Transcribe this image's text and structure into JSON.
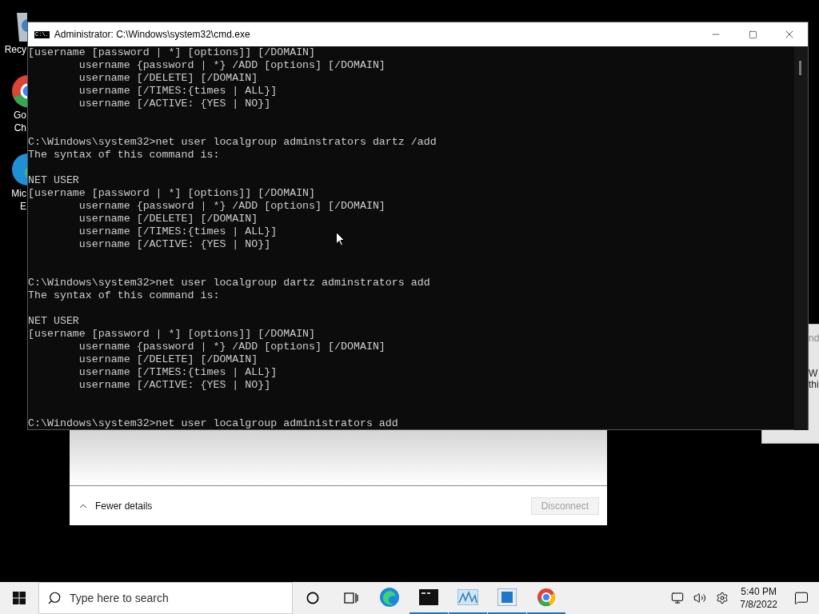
{
  "desktop_icons": [
    {
      "label_lines": [
        "Recy"
      ]
    },
    {
      "label_lines": [
        "Go",
        "Ch"
      ]
    },
    {
      "label_lines": [
        "Mic",
        "E"
      ]
    }
  ],
  "background_window": {
    "texts": [
      "nd",
      "W",
      "thi"
    ]
  },
  "network_dialog": {
    "details_toggle": "Fewer details",
    "disconnect": {
      "label": "Disconnect",
      "disabled": true
    }
  },
  "console": {
    "title": "Administrator: C:\\Windows\\system32\\cmd.exe",
    "icon_text": "C:\\.",
    "lines": [
      {
        "kind": "text",
        "text": "[username [password | *] [options]] [/DOMAIN]"
      },
      {
        "kind": "text",
        "text": "        username {password | *} /ADD [options] [/DOMAIN]"
      },
      {
        "kind": "text",
        "text": "        username [/DELETE] [/DOMAIN]"
      },
      {
        "kind": "text",
        "text": "        username [/TIMES:{times | ALL}]"
      },
      {
        "kind": "text",
        "text": "        username [/ACTIVE: {YES | NO}]"
      },
      {
        "kind": "blank"
      },
      {
        "kind": "blank"
      },
      {
        "kind": "text",
        "text": "C:\\Windows\\system32>net user localgroup adminstrators dartz /add"
      },
      {
        "kind": "text",
        "text": "The syntax of this command is:"
      },
      {
        "kind": "blank"
      },
      {
        "kind": "text",
        "text": "NET USER"
      },
      {
        "kind": "text",
        "text": "[username [password | *] [options]] [/DOMAIN]"
      },
      {
        "kind": "text",
        "text": "        username {password | *} /ADD [options] [/DOMAIN]"
      },
      {
        "kind": "text",
        "text": "        username [/DELETE] [/DOMAIN]"
      },
      {
        "kind": "text",
        "text": "        username [/TIMES:{times | ALL}]"
      },
      {
        "kind": "text",
        "text": "        username [/ACTIVE: {YES | NO}]"
      },
      {
        "kind": "blank"
      },
      {
        "kind": "blank"
      },
      {
        "kind": "text",
        "text": "C:\\Windows\\system32>net user localgroup dartz adminstrators add"
      },
      {
        "kind": "text",
        "text": "The syntax of this command is:"
      },
      {
        "kind": "blank"
      },
      {
        "kind": "text",
        "text": "NET USER"
      },
      {
        "kind": "text",
        "text": "[username [password | *] [options]] [/DOMAIN]"
      },
      {
        "kind": "text",
        "text": "        username {password | *} /ADD [options] [/DOMAIN]"
      },
      {
        "kind": "text",
        "text": "        username [/DELETE] [/DOMAIN]"
      },
      {
        "kind": "text",
        "text": "        username [/TIMES:{times | ALL}]"
      },
      {
        "kind": "text",
        "text": "        username [/ACTIVE: {YES | NO}]"
      },
      {
        "kind": "blank"
      },
      {
        "kind": "blank"
      },
      {
        "kind": "text",
        "text": "C:\\Windows\\system32>net user localgroup administrators add"
      }
    ]
  },
  "taskbar": {
    "search_placeholder": "Type here to search",
    "apps": [
      {
        "kind": "edge",
        "running": false
      },
      {
        "kind": "console",
        "running": true
      },
      {
        "kind": "monitor",
        "running": true
      },
      {
        "kind": "window",
        "running": true
      },
      {
        "kind": "chrome",
        "running": true
      }
    ],
    "time": "5:40 PM",
    "date": "7/8/2022"
  }
}
